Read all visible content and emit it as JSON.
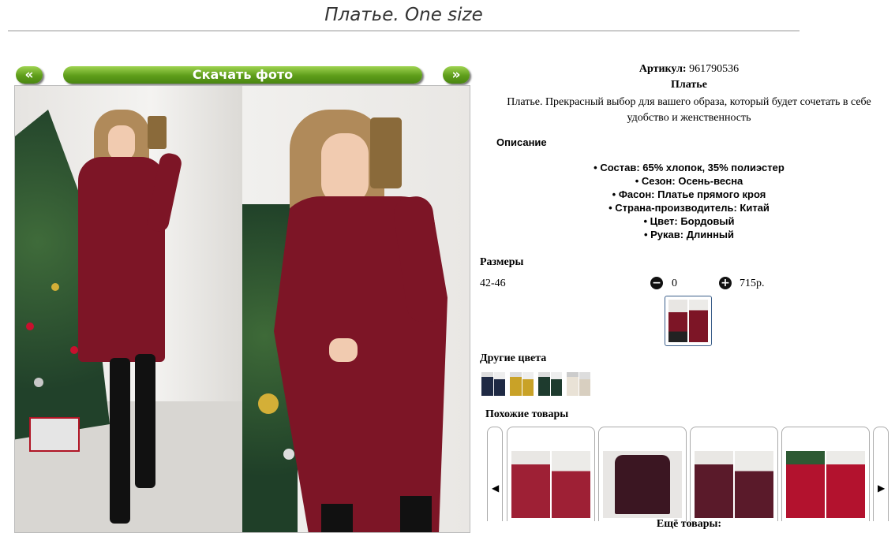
{
  "page": {
    "title": "Платье. One size"
  },
  "gallery": {
    "prev_label": "«",
    "next_label": "»",
    "download_label": "Скачать фото"
  },
  "product": {
    "article_label": "Артикул:",
    "article_value": "961790536",
    "name": "Платье",
    "description_line1": "Платье. Прекрасный выбор для вашего образа, который будет сочетать в себе",
    "description_line2": "удобство и женственность",
    "specs_heading": "Описание",
    "specs": [
      "Состав: 65% хлопок, 35% полиэстер",
      "Сезон: Осень-весна",
      "Фасон: Платье прямого кроя",
      "Страна-производитель: Китай",
      "Цвет: Бордовый",
      "Рукав: Длинный"
    ]
  },
  "sizes": {
    "heading": "Размеры",
    "size": "42-46",
    "minus": "−",
    "plus": "+",
    "quantity": "0",
    "price": "715р."
  },
  "other_colors": {
    "heading": "Другие цвета",
    "swatches": [
      "#1f2a44",
      "#c9a227",
      "#1e3b2e",
      "#e9e2d6"
    ]
  },
  "similar": {
    "heading": "Похожие товары",
    "left_arrow": "◀",
    "right_arrow": "▶"
  },
  "more_products": "Ещё товары:",
  "colors": {
    "accent_green": "#5e9d1a",
    "dress": "#7d1526"
  }
}
